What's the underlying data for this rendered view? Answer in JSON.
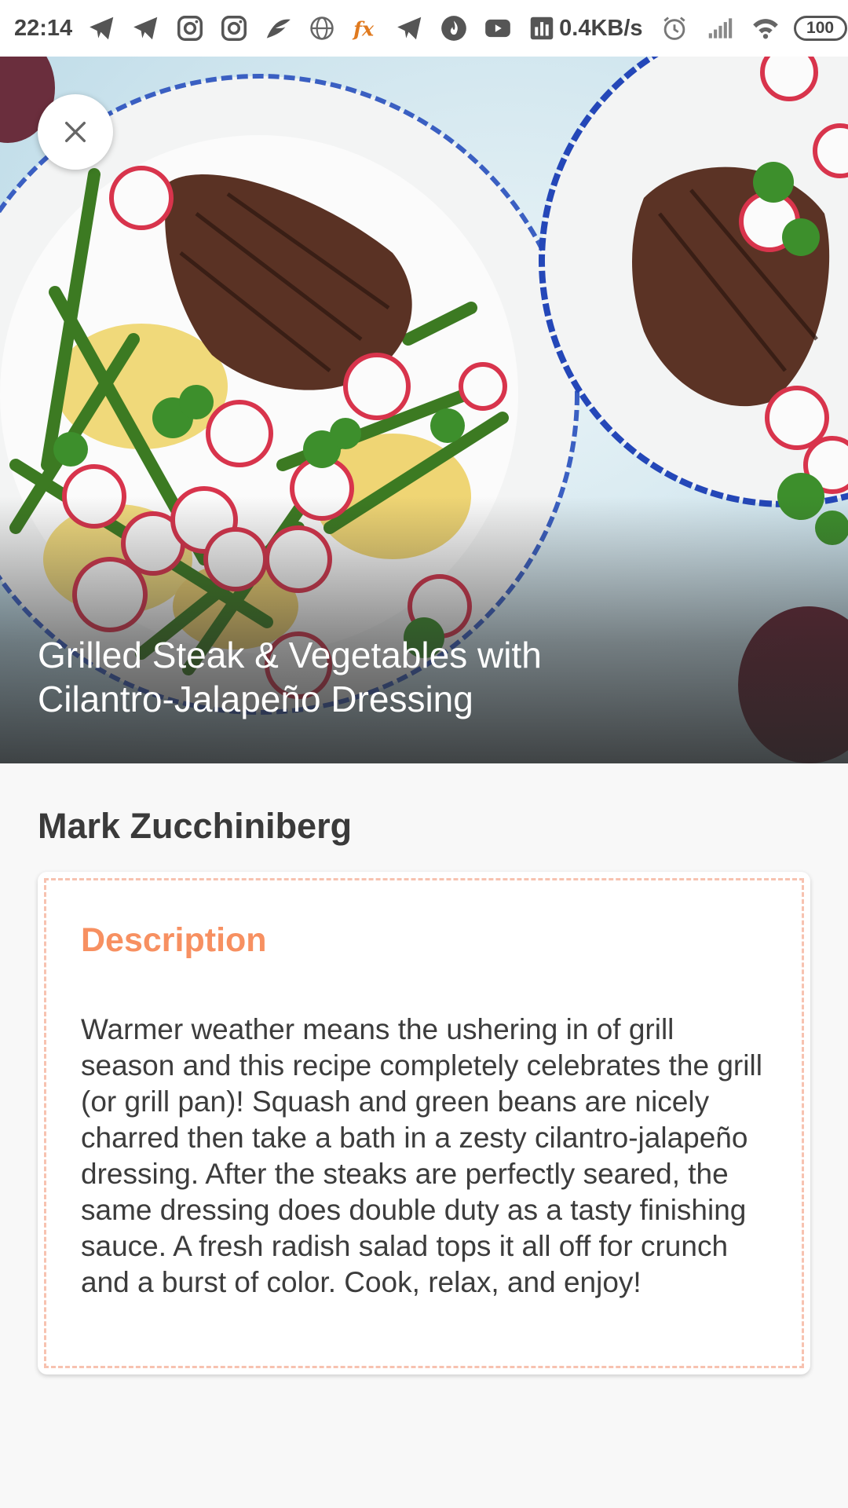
{
  "status_bar": {
    "time": "22:14",
    "speed": "0.4KB/s",
    "battery": "100",
    "icons": [
      "telegram-icon",
      "telegram-icon",
      "instagram-icon",
      "instagram-icon",
      "feather-icon",
      "globe-icon",
      "fx-icon",
      "telegram-icon",
      "fire-icon",
      "youtube-icon",
      "chart-icon",
      "alarm-icon",
      "signal-icon",
      "wifi-icon",
      "battery-icon"
    ]
  },
  "hero": {
    "title": "Grilled Steak & Vegetables with Cilantro-Jalapeño Dressing"
  },
  "author": "Mark Zucchiniberg",
  "description": {
    "heading": "Description",
    "text": "Warmer weather means the ushering in of grill season and this recipe completely celebrates the grill (or grill pan)! Squash and green beans are nicely charred then take a bath in a zesty cilantro-jalapeño dressing. After the steaks are perfectly seared, the same dressing does double duty as a tasty finishing sauce. A fresh radish salad tops it all off for crunch and a burst of color. Cook, relax, and enjoy!"
  },
  "colors": {
    "accent": "#f79061",
    "dash_border": "#f7c2b0",
    "text_primary": "#3a3a3a"
  }
}
